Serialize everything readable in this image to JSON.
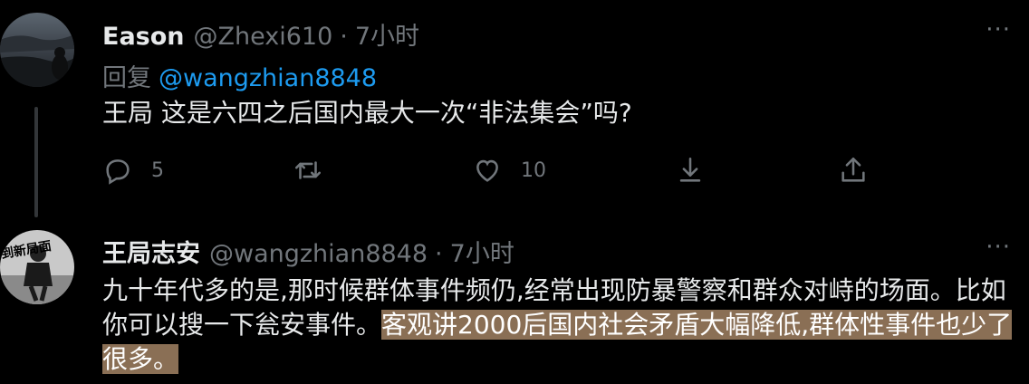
{
  "tweet1": {
    "display_name": "Eason",
    "handle": "@Zhexi610",
    "separator": "·",
    "time": "7小时",
    "more": "···",
    "reply_label": "回复",
    "reply_mention": "@wangzhian8848",
    "text": "王局 这是六四之后国内最大一次“非法集会”吗?",
    "actions": {
      "reply_count": "5",
      "like_count": "10"
    }
  },
  "tweet2": {
    "display_name": "王局志安",
    "handle": "@wangzhian8848",
    "separator": "·",
    "time": "7小时",
    "more": "···",
    "text_plain": "九十年代多的是,那时候群体事件频仍,经常出现防暴警察和群众对峙的场面。比如你可以搜一下瓮安事件。",
    "text_highlight": "客观讲2000后国内社会矛盾大幅降低,群体性事件也少了很多。",
    "avatar_overlay": "到新局面"
  },
  "colors": {
    "background": "#000000",
    "text": "#e7e9ea",
    "muted": "#71767b",
    "link": "#1d9bf0",
    "highlight": "#8a6f55"
  },
  "icons": [
    "reply-icon",
    "retweet-icon",
    "like-icon",
    "download-icon",
    "share-icon",
    "more-icon"
  ]
}
